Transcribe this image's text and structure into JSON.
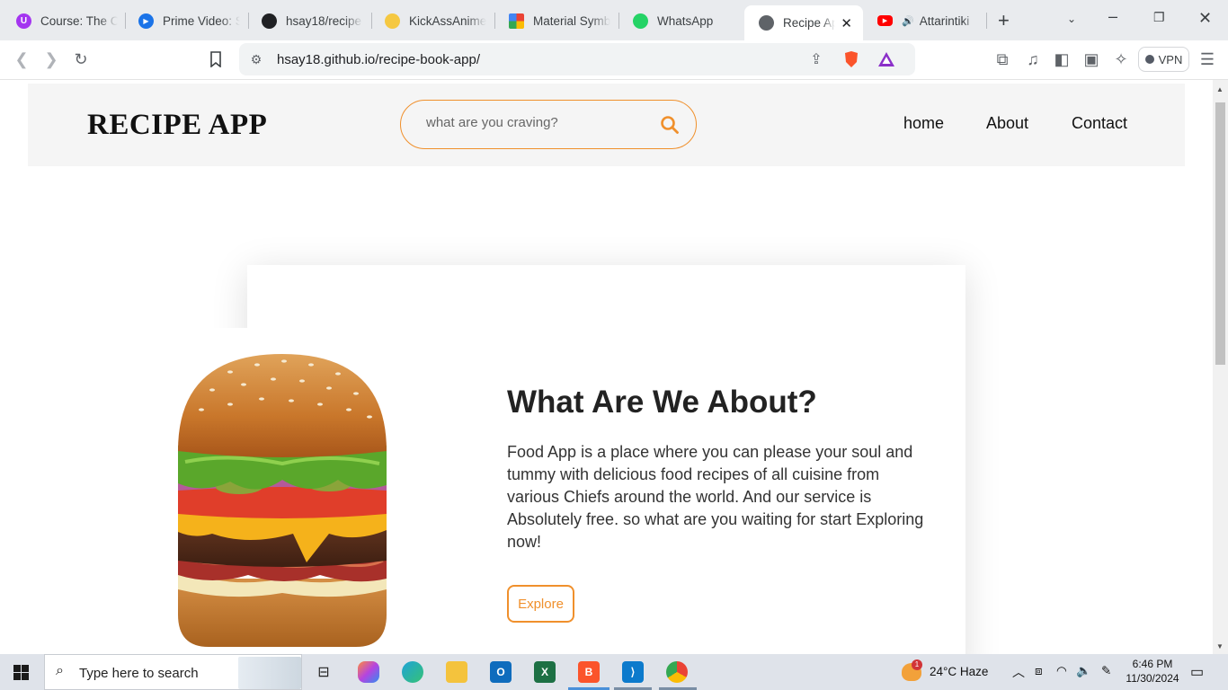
{
  "browser": {
    "tabs": [
      {
        "title": "Course: The C",
        "icon": "udemy-icon",
        "color": "#a435f0"
      },
      {
        "title": "Prime Video: S",
        "icon": "prime-video-icon",
        "color": "#1a73e8"
      },
      {
        "title": "hsay18/recipe",
        "icon": "github-icon",
        "color": "#202124"
      },
      {
        "title": "KickAssAnime",
        "icon": "kickassanime-icon",
        "color": "#f5c842"
      },
      {
        "title": "Material Symb",
        "icon": "material-symbols-icon",
        "color": "#4285f4"
      },
      {
        "title": "WhatsApp",
        "icon": "whatsapp-icon",
        "color": "#25d366"
      },
      {
        "title": "Recipe Ap",
        "icon": "globe-icon",
        "color": "#5f6368",
        "active": true
      },
      {
        "title": "Attarintiki",
        "icon": "youtube-icon",
        "color": "#ff0000"
      }
    ],
    "url": "hsay18.github.io/recipe-book-app/",
    "vpn_label": "VPN"
  },
  "site": {
    "logo": "RECIPE APP",
    "search_placeholder": "what are you craving?",
    "nav": [
      "home",
      "About",
      "Contact"
    ],
    "about": {
      "title": "What Are We About?",
      "text": "Food App is a place where you can please your soul and tummy with delicious food recipes of all cuisine from various Chiefs around the world. And our service is Absolutely free. so what are you waiting for start Exploring now!",
      "button": "Explore"
    },
    "accent_color": "#f0902c"
  },
  "taskbar": {
    "search_placeholder": "Type here to search",
    "weather": "24°C  Haze",
    "time": "6:46 PM",
    "date": "11/30/2024",
    "notification_count": "1"
  }
}
